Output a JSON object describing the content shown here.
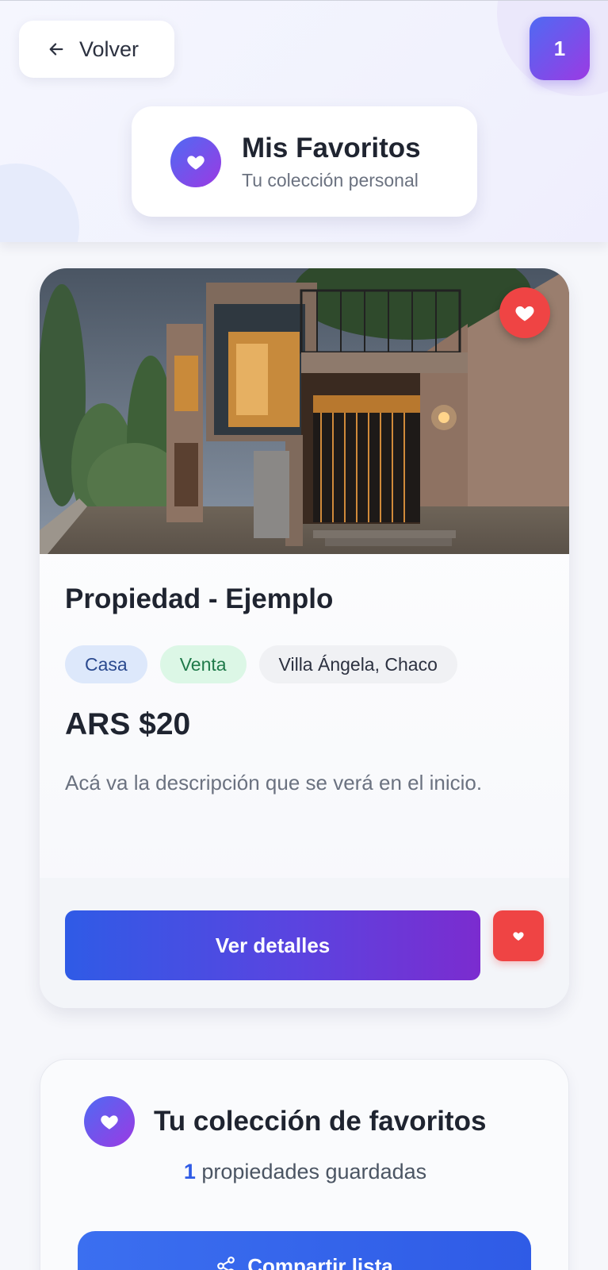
{
  "header": {
    "back_label": "Volver",
    "favorites_count": "1",
    "title": "Mis Favoritos",
    "subtitle": "Tu colección personal"
  },
  "property": {
    "title": "Propiedad - Ejemplo",
    "type": "Casa",
    "operation": "Venta",
    "location": "Villa Ángela, Chaco",
    "price": "ARS $20",
    "description": "Acá va la descripción que se verá en el inicio.",
    "details_label": "Ver detalles"
  },
  "collection": {
    "title": "Tu colección de favoritos",
    "count": "1",
    "count_suffix": " propiedades guardadas",
    "share_label": "Compartir lista"
  },
  "colors": {
    "accent_gradient_start": "#4f6af3",
    "accent_gradient_end": "#9b3ae3",
    "favorite_red": "#ef4444",
    "primary_blue": "#2f5be6"
  },
  "icons": {
    "back": "arrow-left-icon",
    "heart": "heart-icon",
    "share": "share-icon"
  }
}
